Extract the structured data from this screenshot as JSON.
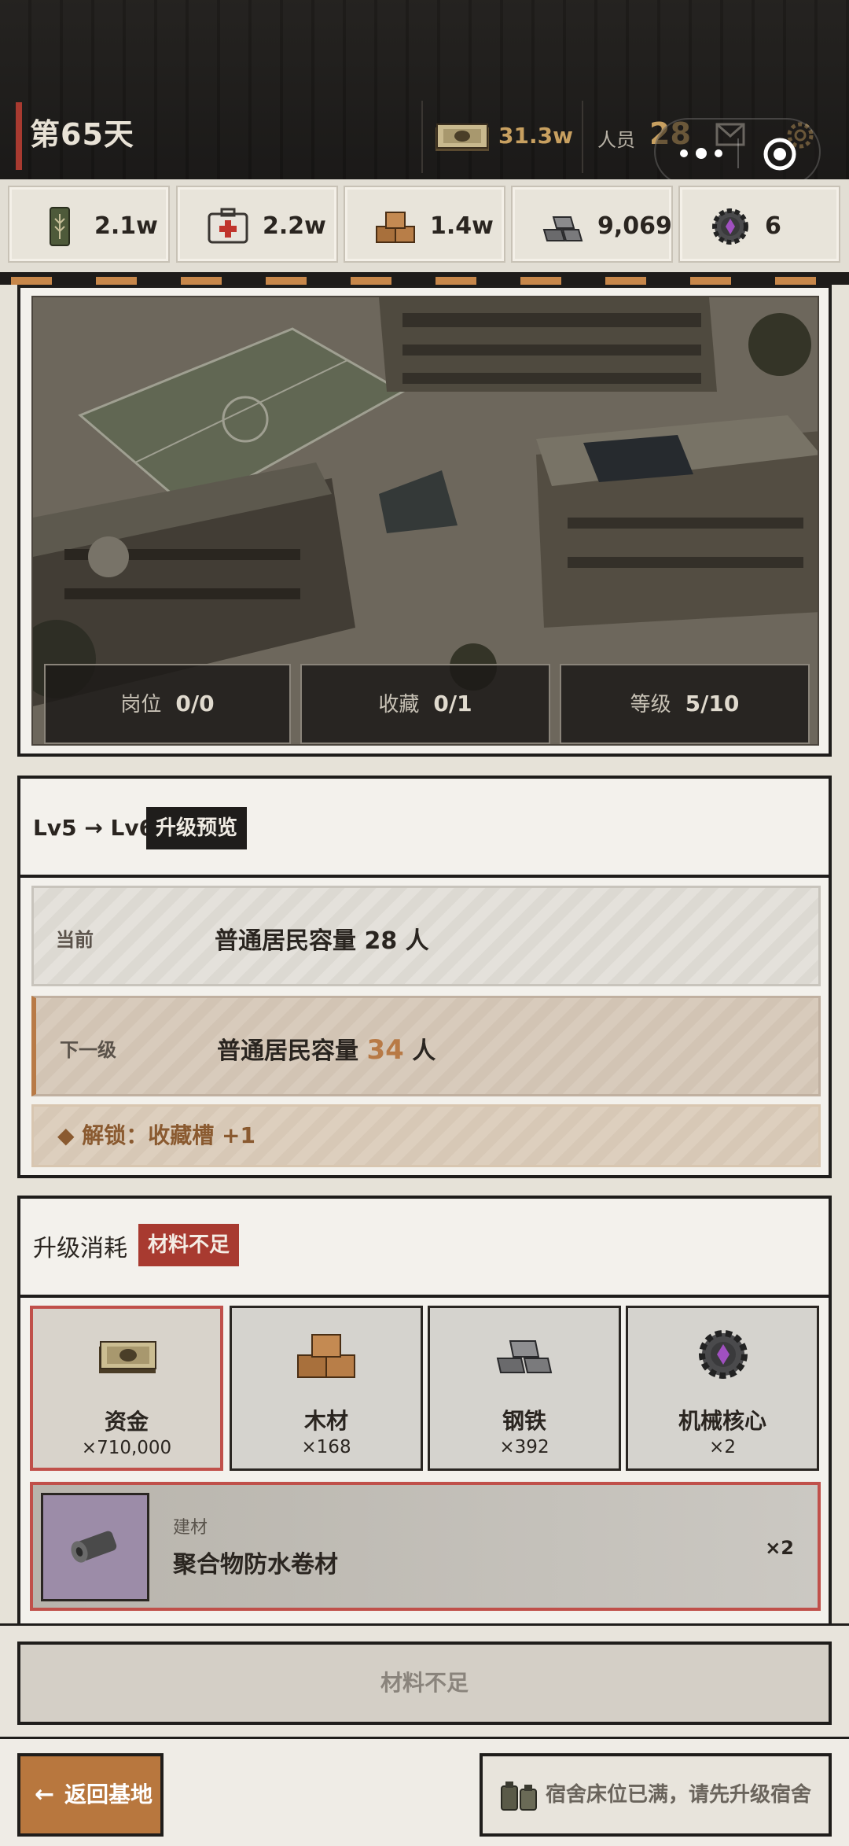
{
  "header": {
    "day": "第65天",
    "cash": "31.3w",
    "staff_label": "人员",
    "staff_count": "28"
  },
  "resources": [
    {
      "name": "food-icon",
      "value": "2.1w"
    },
    {
      "name": "medkit-icon",
      "value": "2.2w"
    },
    {
      "name": "wood-icon",
      "value": "1.4w"
    },
    {
      "name": "steel-icon",
      "value": "9,069"
    },
    {
      "name": "core-icon",
      "value": "6"
    }
  ],
  "building": {
    "stats": [
      {
        "label": "岗位",
        "value": "0/0"
      },
      {
        "label": "收藏",
        "value": "0/1"
      },
      {
        "label": "等级",
        "value": "5/10"
      }
    ]
  },
  "preview": {
    "level": "Lv5 → Lv6",
    "badge": "升级预览",
    "current_label": "当前",
    "current_text": "普通居民容量",
    "current_value": "28",
    "unit": "人",
    "next_label": "下一级",
    "next_text": "普通居民容量",
    "next_value": "34",
    "unlock": "◆ 解锁：收藏槽 +1"
  },
  "cost": {
    "title": "升级消耗",
    "badge": "材料不足",
    "materials": [
      {
        "name": "资金",
        "qty": "×710,000",
        "icon": "cash-icon",
        "insufficient": true
      },
      {
        "name": "木材",
        "qty": "×168",
        "icon": "wood-icon",
        "insufficient": false
      },
      {
        "name": "钢铁",
        "qty": "×392",
        "icon": "steel-icon",
        "insufficient": false
      },
      {
        "name": "机械核心",
        "qty": "×2",
        "icon": "core-icon",
        "insufficient": false
      }
    ],
    "item": {
      "category": "建材",
      "name": "聚合物防水卷材",
      "qty": "×2",
      "icon": "membrane-roll-icon"
    }
  },
  "actions": {
    "upgrade_button": "材料不足",
    "back_button": "返回基地",
    "notice": "宿舍床位已满，请先升级宿舍"
  },
  "colors": {
    "accent": "#b87a46",
    "warning": "#a83a30",
    "gold": "#c8a060",
    "frame": "#1f1d1b"
  }
}
